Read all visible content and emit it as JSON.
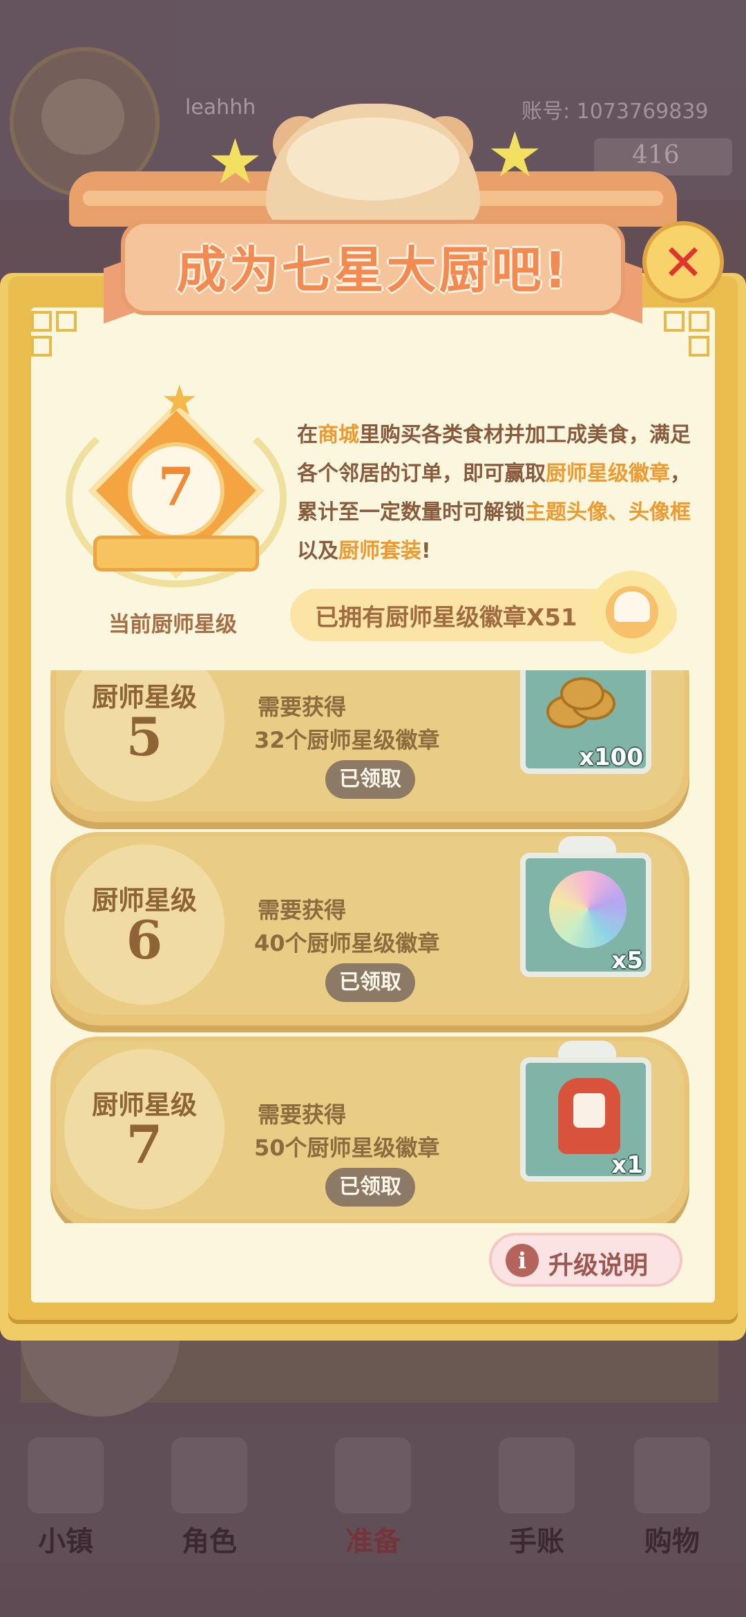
{
  "background": {
    "username": "leahhh",
    "account_label": "账号: 1073769839",
    "coins": "416",
    "nav": [
      {
        "label": "小镇",
        "icon": "map-icon"
      },
      {
        "label": "角色",
        "icon": "character-icon"
      },
      {
        "label": "准备",
        "icon": "kitchen-icon",
        "active": true
      },
      {
        "label": "手账",
        "icon": "journal-icon"
      },
      {
        "label": "购物",
        "icon": "shopping-bag-icon"
      }
    ]
  },
  "modal": {
    "title": "成为七星大厨吧!",
    "close_icon": "close-icon",
    "badge": {
      "level": "7",
      "caption": "当前厨师星级"
    },
    "description": {
      "p1": "在",
      "shop": "商城",
      "p2": "里购买各类食材并加工成美食，满足各个邻居的订单，即可赢取",
      "badge_word": "厨师星级徽章",
      "p3": "，累计至一定数量时可解锁",
      "theme_avatar": "主题头像、头像框",
      "p4": "以及",
      "chef_set": "厨师套装",
      "p5": "!"
    },
    "owned_badges": "已拥有厨师星级徽章X51",
    "rewards": [
      {
        "level_label": "厨师星级",
        "level": "5",
        "need_label": "需要获得",
        "count_text": "32个厨师星级徽章",
        "status": "已领取",
        "reward_icon": "gold-coins-icon",
        "quantity": "x100"
      },
      {
        "level_label": "厨师星级",
        "level": "6",
        "need_label": "需要获得",
        "count_text": "40个厨师星级徽章",
        "status": "已领取",
        "reward_icon": "rainbow-flower-icon",
        "quantity": "x5"
      },
      {
        "level_label": "厨师星级",
        "level": "7",
        "need_label": "需要获得",
        "count_text": "50个厨师星级徽章",
        "status": "已领取",
        "reward_icon": "chef-outfit-icon",
        "quantity": "x1"
      }
    ],
    "upgrade_button": "升级说明",
    "upgrade_icon_text": "i"
  }
}
